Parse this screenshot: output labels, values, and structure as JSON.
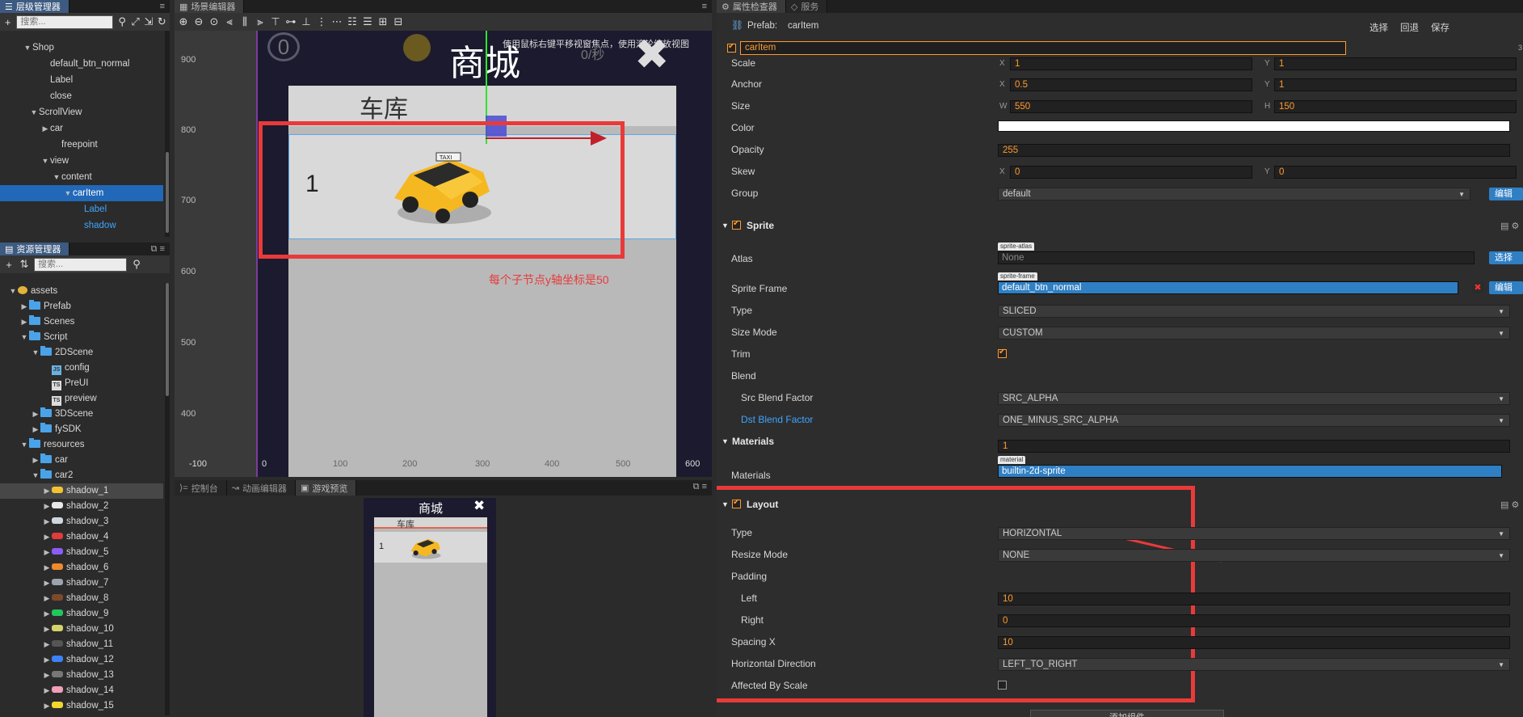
{
  "hierarchy": {
    "tab": "层级管理器",
    "search_placeholder": "搜索...",
    "nodes": [
      {
        "label": "Shop",
        "arrow": "▼"
      },
      {
        "label": "default_btn_normal",
        "arrow": ""
      },
      {
        "label": "Label",
        "arrow": ""
      },
      {
        "label": "close",
        "arrow": ""
      },
      {
        "label": "ScrollView",
        "arrow": "▼"
      },
      {
        "label": "car",
        "arrow": "▶"
      },
      {
        "label": "freepoint",
        "arrow": ""
      },
      {
        "label": "view",
        "arrow": "▼"
      },
      {
        "label": "content",
        "arrow": "▼"
      },
      {
        "label": "carItem",
        "arrow": "▼"
      },
      {
        "label": "Label",
        "arrow": ""
      },
      {
        "label": "shadow",
        "arrow": ""
      }
    ]
  },
  "assets": {
    "tab": "资源管理器",
    "search_placeholder": "搜索...",
    "items": [
      {
        "label": "assets",
        "arrow": "▼",
        "icon": "db"
      },
      {
        "label": "Prefab",
        "arrow": "▶",
        "icon": "folder"
      },
      {
        "label": "Scenes",
        "arrow": "▶",
        "icon": "folder"
      },
      {
        "label": "Script",
        "arrow": "▼",
        "icon": "folder"
      },
      {
        "label": "2DScene",
        "arrow": "▼",
        "icon": "folder"
      },
      {
        "label": "config",
        "arrow": "",
        "icon": "js"
      },
      {
        "label": "PreUI",
        "arrow": "",
        "icon": "ts"
      },
      {
        "label": "preview",
        "arrow": "",
        "icon": "ts"
      },
      {
        "label": "3DScene",
        "arrow": "▶",
        "icon": "folder"
      },
      {
        "label": "fySDK",
        "arrow": "▶",
        "icon": "folder"
      },
      {
        "label": "resources",
        "arrow": "▼",
        "icon": "folder"
      },
      {
        "label": "car",
        "arrow": "▶",
        "icon": "folder"
      },
      {
        "label": "car2",
        "arrow": "▼",
        "icon": "folder"
      },
      {
        "label": "shadow_1",
        "arrow": "▶",
        "icon": "car",
        "color": "#f2c230"
      },
      {
        "label": "shadow_2",
        "arrow": "▶",
        "icon": "car",
        "color": "#e8e8e8"
      },
      {
        "label": "shadow_3",
        "arrow": "▶",
        "icon": "car",
        "color": "#cfd6dd"
      },
      {
        "label": "shadow_4",
        "arrow": "▶",
        "icon": "car",
        "color": "#e23b3b"
      },
      {
        "label": "shadow_5",
        "arrow": "▶",
        "icon": "car",
        "color": "#8b5cf6"
      },
      {
        "label": "shadow_6",
        "arrow": "▶",
        "icon": "car",
        "color": "#ef8a2b"
      },
      {
        "label": "shadow_7",
        "arrow": "▶",
        "icon": "car",
        "color": "#9ca3af"
      },
      {
        "label": "shadow_8",
        "arrow": "▶",
        "icon": "car",
        "color": "#7c4a2a"
      },
      {
        "label": "shadow_9",
        "arrow": "▶",
        "icon": "car",
        "color": "#22c55e"
      },
      {
        "label": "shadow_10",
        "arrow": "▶",
        "icon": "car",
        "color": "#d4d36a"
      },
      {
        "label": "shadow_11",
        "arrow": "▶",
        "icon": "car",
        "color": "#555555"
      },
      {
        "label": "shadow_12",
        "arrow": "▶",
        "icon": "car",
        "color": "#3b82f6"
      },
      {
        "label": "shadow_13",
        "arrow": "▶",
        "icon": "car",
        "color": "#777777"
      },
      {
        "label": "shadow_14",
        "arrow": "▶",
        "icon": "car",
        "color": "#f2a0b5"
      },
      {
        "label": "shadow_15",
        "arrow": "▶",
        "icon": "car",
        "color": "#f2d630"
      }
    ]
  },
  "scene": {
    "tab": "场景编辑器",
    "hint": "使用鼠标右键平移视窗焦点，使用滚轮缩放视图",
    "y_ticks": [
      "900",
      "800",
      "700",
      "600",
      "500",
      "400"
    ],
    "x_ticks": [
      "-100",
      "0",
      "100",
      "200",
      "300",
      "400",
      "500",
      "600"
    ],
    "shop_title": "商城",
    "garage_title": "车库",
    "item_number": "1",
    "annotation": "每个子节点y轴坐标是50",
    "hud_zero": "0",
    "hud_time": "0/秒"
  },
  "bottom_tabs": {
    "console": "控制台",
    "animation": "动画编辑器",
    "preview": "游戏预览"
  },
  "preview": {
    "shop_title": "商城",
    "garage_title": "车库",
    "item_number": "1"
  },
  "inspector": {
    "tab": "属性检查器",
    "tab2": "服务",
    "prefab_label": "Prefab:",
    "prefab_name": "carItem",
    "prefab_actions": [
      "选择",
      "回退",
      "保存"
    ],
    "node_name": "carItem",
    "node_extra": "3",
    "scale": {
      "label": "Scale",
      "x": "1",
      "y": "1"
    },
    "anchor": {
      "label": "Anchor",
      "x": "0.5",
      "y": "1"
    },
    "size": {
      "label": "Size",
      "w": "550",
      "h": "150"
    },
    "color_label": "Color",
    "opacity": {
      "label": "Opacity",
      "value": "255"
    },
    "skew": {
      "label": "Skew",
      "x": "0",
      "y": "0"
    },
    "group": {
      "label": "Group",
      "value": "default",
      "button": "编辑"
    },
    "sprite": {
      "title": "Sprite",
      "atlas_label": "Atlas",
      "atlas_tag": "sprite-atlas",
      "atlas_value": "None",
      "atlas_button": "选择",
      "frame_label": "Sprite Frame",
      "frame_tag": "sprite-frame",
      "frame_value": "default_btn_normal",
      "frame_button": "编辑",
      "type_label": "Type",
      "type_value": "SLICED",
      "sizemode_label": "Size Mode",
      "sizemode_value": "CUSTOM",
      "trim_label": "Trim",
      "blend_label": "Blend",
      "src_label": "Src Blend Factor",
      "src_value": "SRC_ALPHA",
      "dst_label": "Dst Blend Factor",
      "dst_value": "ONE_MINUS_SRC_ALPHA"
    },
    "materials": {
      "title": "Materials",
      "count": "1",
      "label": "Materials",
      "tag": "material",
      "value": "builtin-2d-sprite"
    },
    "layout": {
      "title": "Layout",
      "type_label": "Type",
      "type_value": "HORIZONTAL",
      "resize_label": "Resize Mode",
      "resize_value": "NONE",
      "padding_label": "Padding",
      "left_label": "Left",
      "left_value": "10",
      "right_label": "Right",
      "right_value": "0",
      "spacing_label": "Spacing X",
      "spacing_value": "10",
      "dir_label": "Horizontal Direction",
      "dir_value": "LEFT_TO_RIGHT",
      "affected_label": "Affected By Scale",
      "bottom_button": "添加组件"
    }
  }
}
